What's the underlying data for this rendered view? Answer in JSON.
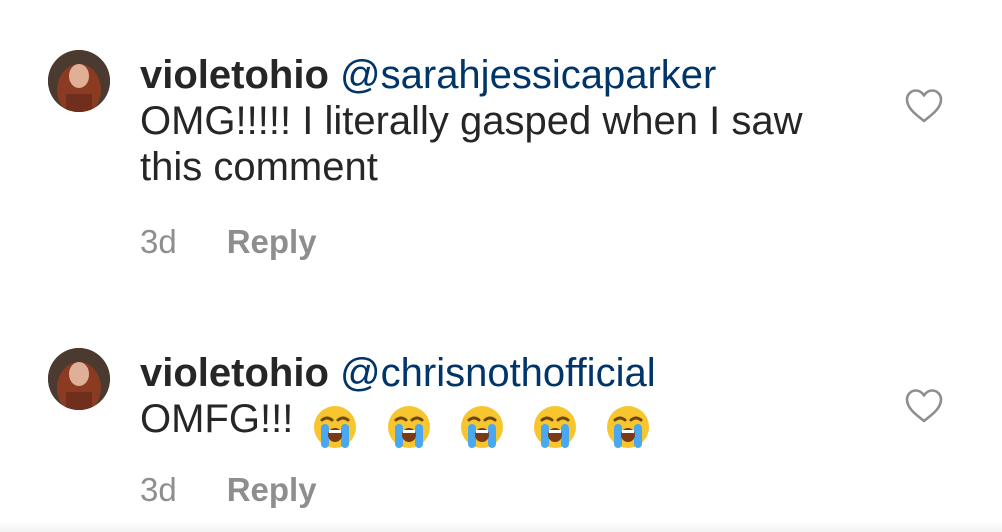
{
  "comments": [
    {
      "username": "violetohio",
      "mention": "@sarahjessicaparker",
      "text": "OMG!!!!! I literally gasped when I saw this comment",
      "emojis": [],
      "time": "3d",
      "reply_label": "Reply",
      "like_icon": "heart-outline-icon"
    },
    {
      "username": "violetohio",
      "mention": "@chrisnothofficial",
      "text": "OMFG!!!",
      "emojis": [
        "😭",
        "😭",
        "😭",
        "😭",
        "😭"
      ],
      "time": "3d",
      "reply_label": "Reply",
      "like_icon": "heart-outline-icon"
    }
  ],
  "colors": {
    "text": "#262626",
    "mention": "#003569",
    "muted": "#8e8e8e"
  }
}
